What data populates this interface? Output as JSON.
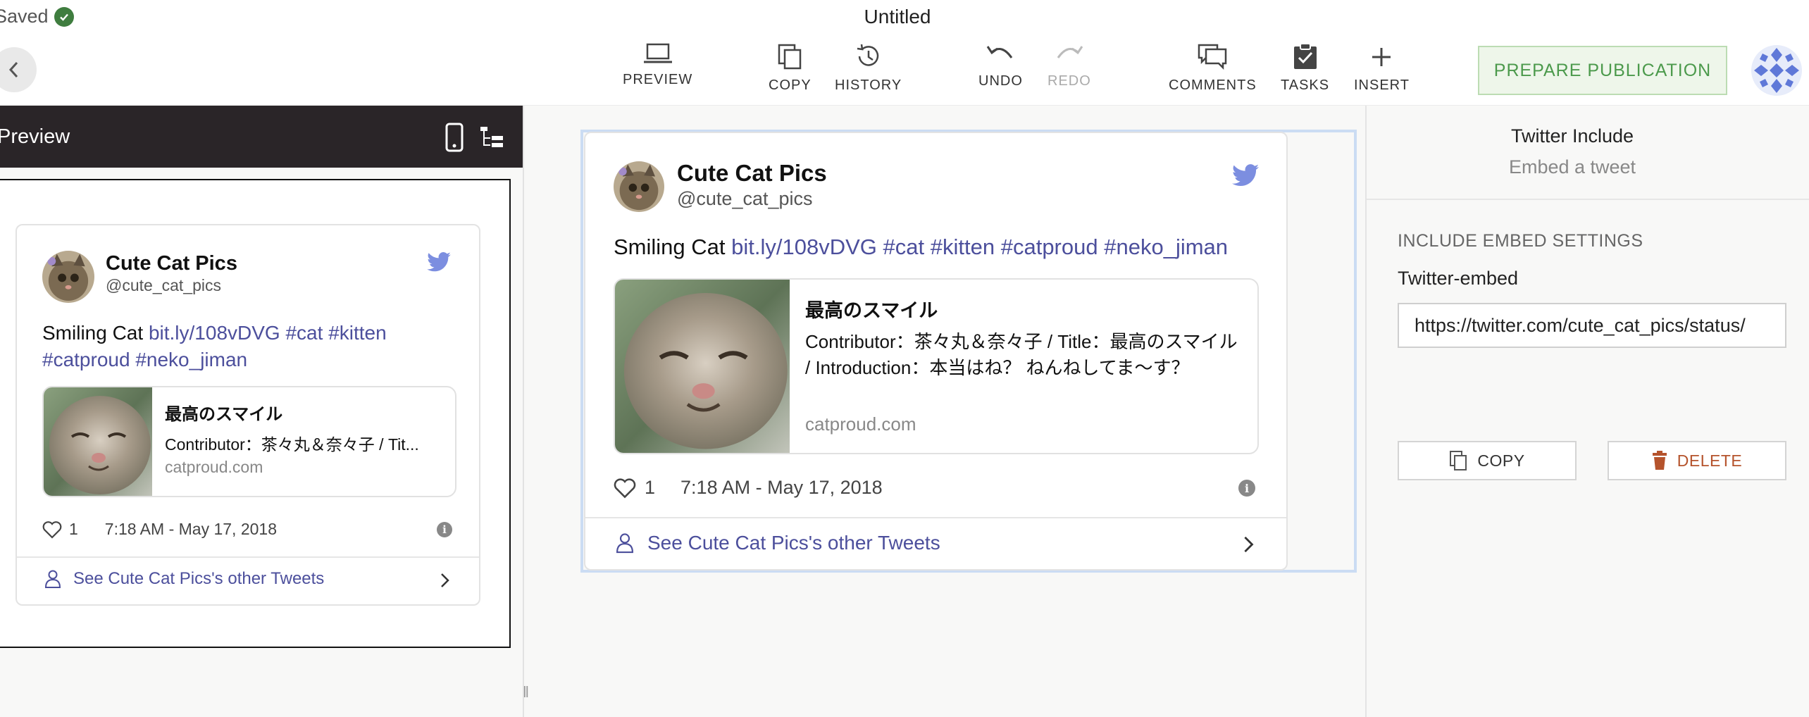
{
  "header": {
    "saved_label": "Saved",
    "doc_title": "Untitled",
    "tools": {
      "preview": "PREVIEW",
      "copy": "COPY",
      "history": "HISTORY",
      "undo": "UNDO",
      "redo": "REDO",
      "comments": "COMMENTS",
      "tasks": "TASKS",
      "insert": "INSERT"
    },
    "prepare_label": "PREPARE PUBLICATION"
  },
  "preview_panel": {
    "title": "Preview"
  },
  "tweet": {
    "name": "Cute Cat Pics",
    "handle": "@cute_cat_pics",
    "text_plain": "Smiling Cat",
    "link": "bit.ly/108vDVG",
    "hashtags": [
      "#cat",
      "#kitten",
      "#catproud",
      "#neko_jiman"
    ],
    "card": {
      "title": "最高のスマイル",
      "description": "Contributor：茶々丸＆奈々子 / Title：最高のスマイル / Introduction：本当はね？ ねんねしてま〜す？",
      "description_short": "Contributor：茶々丸＆奈々子 / Tit...",
      "domain": "catproud.com"
    },
    "likes": "1",
    "timestamp": "7:18 AM - May 17, 2018",
    "footer_link": "See Cute Cat Pics's other Tweets"
  },
  "sidebar": {
    "title": "Twitter Include",
    "subtitle": "Embed a tweet",
    "section": "INCLUDE EMBED SETTINGS",
    "field_label": "Twitter-embed",
    "field_value": "https://twitter.com/cute_cat_pics/status/",
    "copy_label": "COPY",
    "delete_label": "DELETE"
  },
  "colors": {
    "link": "#4c4f9c",
    "twitter_bird": "#7c8ee0",
    "prepare_green": "#4c9a4c",
    "delete_red": "#b5532c",
    "preview_header": "#2a2528"
  }
}
